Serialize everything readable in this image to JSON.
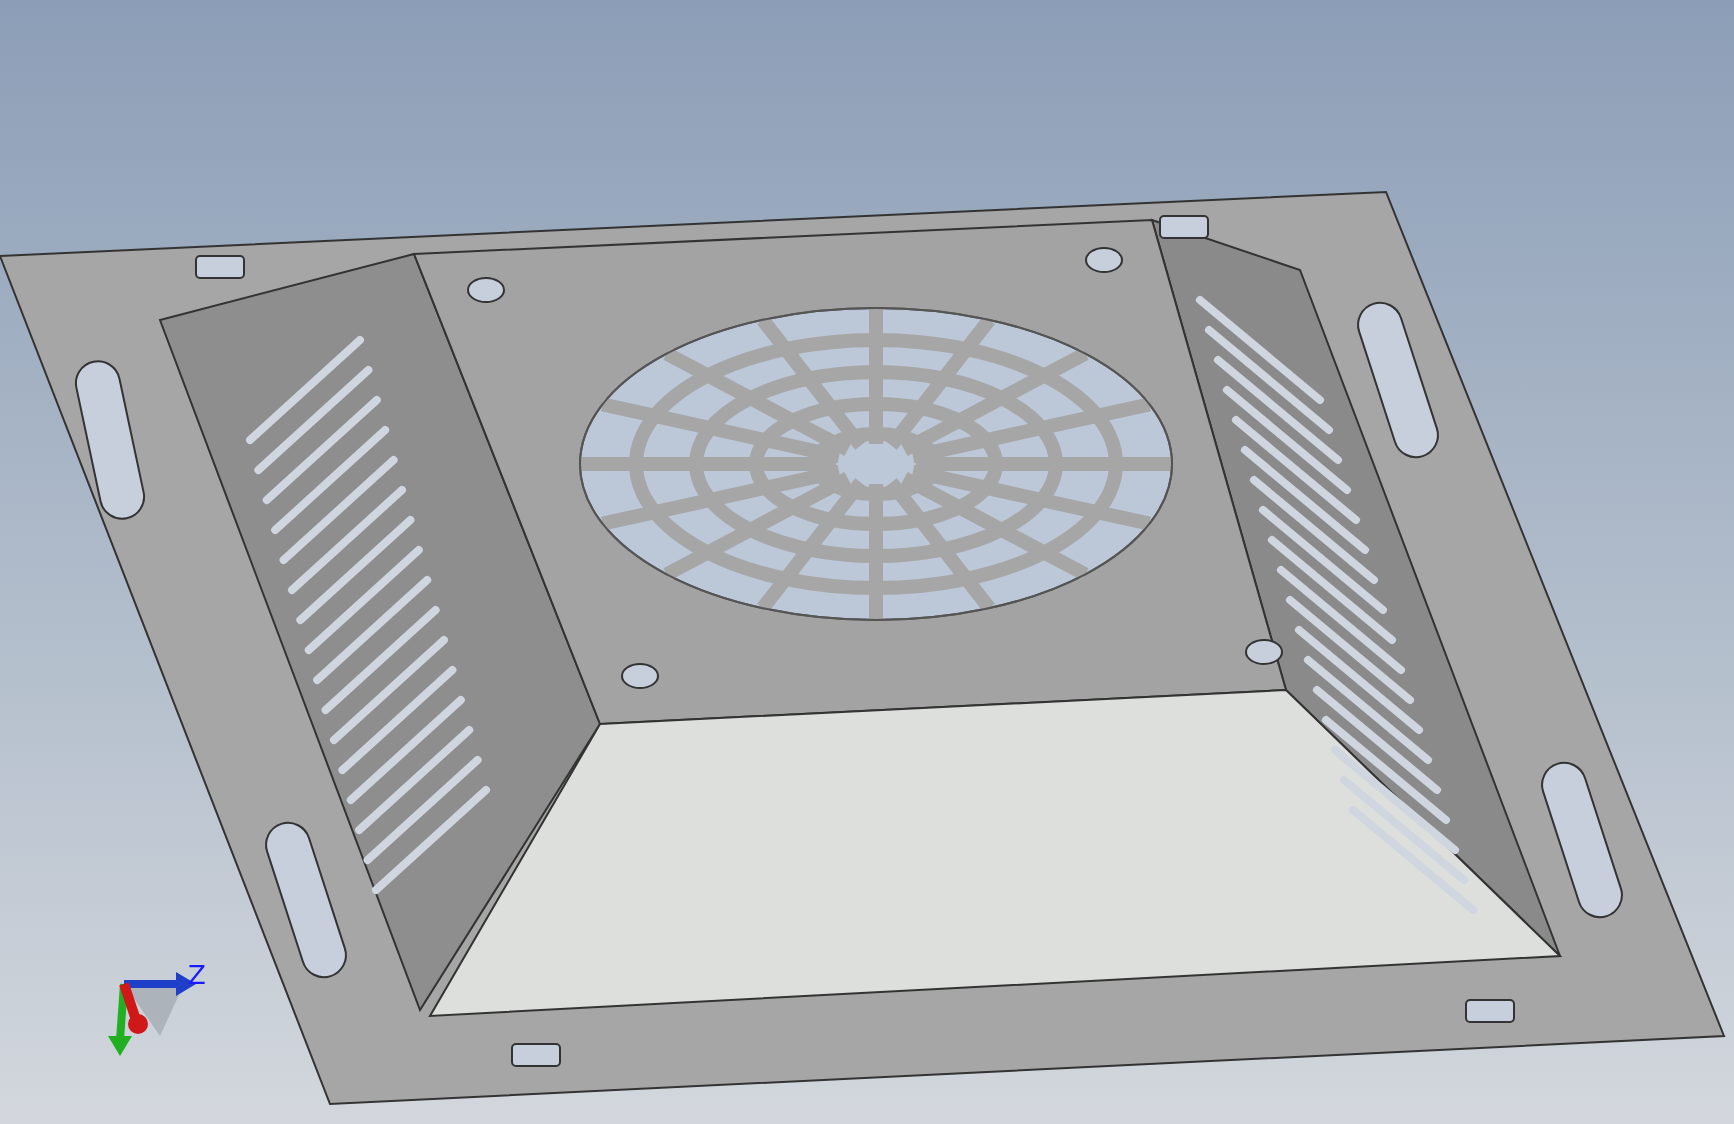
{
  "viewport": {
    "triad": {
      "axis_label": "Z"
    }
  }
}
